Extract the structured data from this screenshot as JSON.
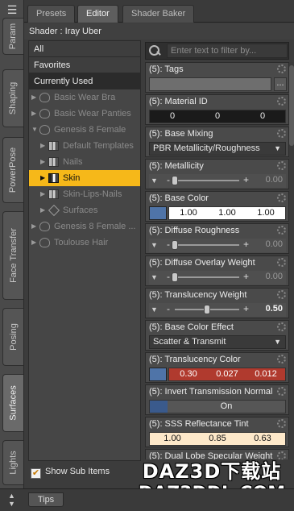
{
  "vertical_tabs": [
    {
      "label": "Param",
      "active": false
    },
    {
      "label": "Shaping",
      "active": false
    },
    {
      "label": "PowerPose",
      "active": false
    },
    {
      "label": "Face Transfer",
      "active": false
    },
    {
      "label": "Posing",
      "active": false
    },
    {
      "label": "Surfaces",
      "active": true
    },
    {
      "label": "Lights",
      "active": false
    }
  ],
  "top_tabs": [
    {
      "label": "Presets",
      "active": false
    },
    {
      "label": "Editor",
      "active": true
    },
    {
      "label": "Shader Baker",
      "active": false
    }
  ],
  "shader_label": "Shader : Iray Uber",
  "presets": [
    "All",
    "Favorites",
    "Currently Used"
  ],
  "tree": [
    {
      "label": "Basic Wear Bra"
    },
    {
      "label": "Basic Wear Panties"
    },
    {
      "label": "Genesis 8 Female"
    },
    {
      "label": "Default Templates"
    },
    {
      "label": "Nails"
    },
    {
      "label": "Skin",
      "selected": true
    },
    {
      "label": "Skin-Lips-Nails"
    },
    {
      "label": "Surfaces"
    },
    {
      "label": "Genesis 8 Female ..."
    },
    {
      "label": "Toulouse Hair"
    }
  ],
  "show_sub_items": {
    "label": "Show Sub Items",
    "checked": true
  },
  "filter": {
    "placeholder": "Enter text to filter by..."
  },
  "properties": {
    "tags": {
      "title": "(5): Tags",
      "button": "..."
    },
    "material_id": {
      "title": "(5): Material ID",
      "values": [
        "0",
        "0",
        "0"
      ]
    },
    "base_mixing": {
      "title": "(5): Base Mixing",
      "value": "PBR Metallicity/Roughness"
    },
    "metallicity": {
      "title": "(5): Metallicity",
      "value": "0.00",
      "level": 0
    },
    "base_color": {
      "title": "(5): Base Color",
      "values": [
        "1.00",
        "1.00",
        "1.00"
      ],
      "swatch": "#4f74a8"
    },
    "diffuse_roughness": {
      "title": "(5): Diffuse Roughness",
      "value": "0.00",
      "level": 0
    },
    "diffuse_overlay_weight": {
      "title": "(5): Diffuse Overlay Weight",
      "value": "0.00",
      "level": 0
    },
    "translucency_weight": {
      "title": "(5): Translucency Weight",
      "value": "0.50",
      "level": 0.5
    },
    "base_color_effect": {
      "title": "(5): Base Color Effect",
      "value": "Scatter & Transmit"
    },
    "translucency_color": {
      "title": "(5): Translucency Color",
      "values": [
        "0.30",
        "0.027",
        "0.012"
      ],
      "swatch": "#4f74a8",
      "bg": "#b03a2e"
    },
    "invert_transmission_normal": {
      "title": "(5): Invert Transmission Normal",
      "value": "On"
    },
    "sss_reflectance_tint": {
      "title": "(5): SSS Reflectance Tint",
      "values": [
        "1.00",
        "0.85",
        "0.63"
      ],
      "bg": "#fde8c9"
    },
    "dual_lobe": {
      "title": "(5): Dual Lobe Specular Weight"
    }
  },
  "watermark": {
    "line1": "DAZ3D下载站",
    "line2": "DAZ3DDL.COM"
  },
  "bottom": {
    "tips_label": "Tips"
  }
}
